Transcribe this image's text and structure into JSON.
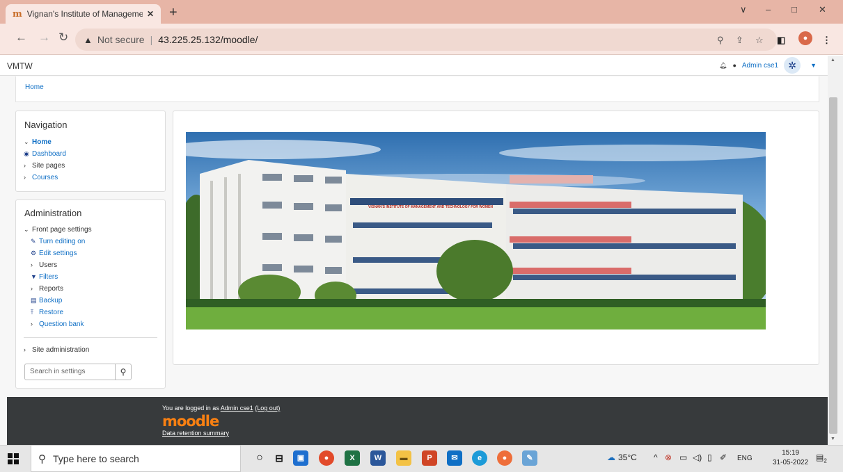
{
  "browser": {
    "tab_title": "Vignan's Institute of Managemen",
    "tab_favicon": "moodle-hat-icon",
    "not_secure": "Not secure",
    "url": "43.225.25.132/moodle/",
    "window_controls": [
      "∨",
      "–",
      "□",
      "✕"
    ]
  },
  "moodle": {
    "brand": "VMTW",
    "user_name": "Admin cse1",
    "breadcrumb": "Home",
    "navigation": {
      "title": "Navigation",
      "items": [
        {
          "label": "Home",
          "type": "expanded"
        },
        {
          "label": "Dashboard",
          "type": "link",
          "icon": "dashboard-icon"
        },
        {
          "label": "Site pages",
          "type": "collapsed"
        },
        {
          "label": "Courses",
          "type": "collapsed-link"
        }
      ]
    },
    "administration": {
      "title": "Administration",
      "items": [
        {
          "label": "Front page settings",
          "type": "expanded"
        },
        {
          "label": "Turn editing on",
          "type": "link",
          "icon": "pencil-icon"
        },
        {
          "label": "Edit settings",
          "type": "link",
          "icon": "gear-icon"
        },
        {
          "label": "Users",
          "type": "collapsed"
        },
        {
          "label": "Filters",
          "type": "link",
          "icon": "filter-icon"
        },
        {
          "label": "Reports",
          "type": "collapsed"
        },
        {
          "label": "Backup",
          "type": "link",
          "icon": "backup-icon"
        },
        {
          "label": "Restore",
          "type": "link",
          "icon": "restore-icon"
        },
        {
          "label": "Question bank",
          "type": "collapsed-link"
        }
      ],
      "site_administration": "Site administration",
      "search_placeholder": "Search in settings"
    },
    "banner_sign": "VIGNAN'S INSTITUTE OF MANAGEMENT AND TECHNOLOGY FOR WOMEN",
    "footer": {
      "logged_in_prefix": "You are logged in as ",
      "user_link": "Admin cse1",
      "logout": "(Log out)",
      "logo": "moodle",
      "data_retention": "Data retention summary"
    }
  },
  "taskbar": {
    "search_placeholder": "Type here to search",
    "weather": "35°C",
    "language": "ENG",
    "time": "15:19",
    "date": "31-05-2022",
    "notifications": "2"
  }
}
